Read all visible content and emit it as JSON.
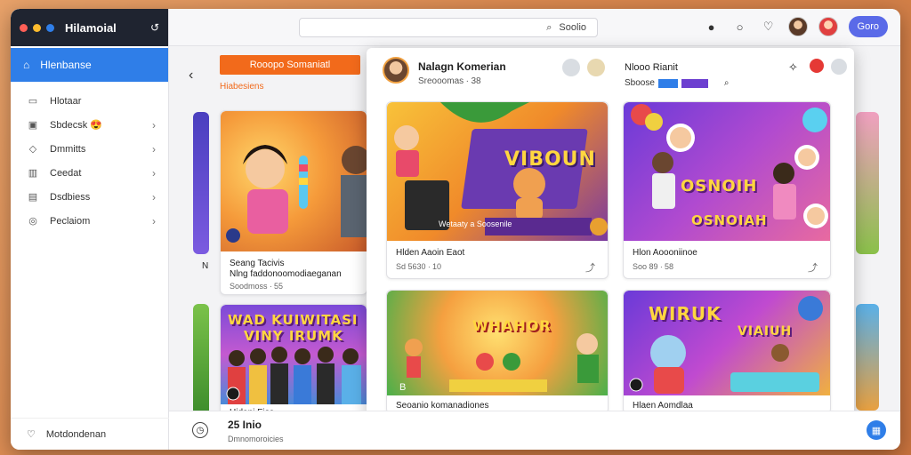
{
  "window": {
    "app_title": "Hilamoial",
    "traffic_colors": [
      "#ff5f57",
      "#febc2e",
      "#2f7ee8"
    ]
  },
  "sidebar": {
    "active_label": "Hlenbanse",
    "items": [
      {
        "label": "Hlotaar",
        "icon": "folder-icon"
      },
      {
        "label": "Sbdecsk",
        "icon": "game-icon",
        "emoji": "😍"
      },
      {
        "label": "Dmmitts",
        "icon": "shield-icon"
      },
      {
        "label": "Ceedat",
        "icon": "chart-icon"
      },
      {
        "label": "Dsdbiess",
        "icon": "monitor-icon"
      },
      {
        "label": "Peclaiom",
        "icon": "settings-icon"
      }
    ],
    "bottom_label": "Motdondenan"
  },
  "topbar": {
    "search_label": "Soolio",
    "open_button": "Goro"
  },
  "content": {
    "orange_button": "Rooopo Somaniatl",
    "section_label": "Hiabesiens",
    "cards": [
      {
        "title": "Seang Tacivis",
        "subtitle": "Nlng faddonoomodiaeganan",
        "meta": "Soodmoss ∙ 55"
      },
      {
        "title": "Hidani Fios",
        "subtitle": "",
        "meta": ""
      }
    ],
    "left_card_label": "N"
  },
  "panel": {
    "name": "Nalagn Komerian",
    "subtitle": "Sreooomas ∙ 38",
    "name2": "Nlooo Rianit",
    "subtitle2": "Sboose",
    "cards": [
      {
        "title": "Hlden Aaoin Eaot",
        "meta": "Sd 5630 ∙ 10",
        "overlay": "VIBOUN",
        "caption": "Wetaaty a Soosenile"
      },
      {
        "title": "Hlon Aoooniinoe",
        "meta": "Soo 89 ∙ 58",
        "overlay": "OSNOIH",
        "overlay2": "OSNOIAH"
      },
      {
        "title": "Seoanio komanadiones",
        "meta": "",
        "overlay": "WHAHOR"
      },
      {
        "title": "Hlaen Aomdlaa",
        "meta": "",
        "overlay": "WIRUK",
        "overlay2": "VIAIUH"
      }
    ]
  },
  "bottom": {
    "title": "25 Inio",
    "subtitle": "Dmnomoroicies"
  },
  "big_card_overlay": [
    "WAD KUIWITASI",
    "VINY IRUMK"
  ],
  "colors": {
    "accent_blue": "#2f7ee8",
    "accent_orange": "#f26a1b",
    "sidebar_dark": "#1f2430"
  }
}
